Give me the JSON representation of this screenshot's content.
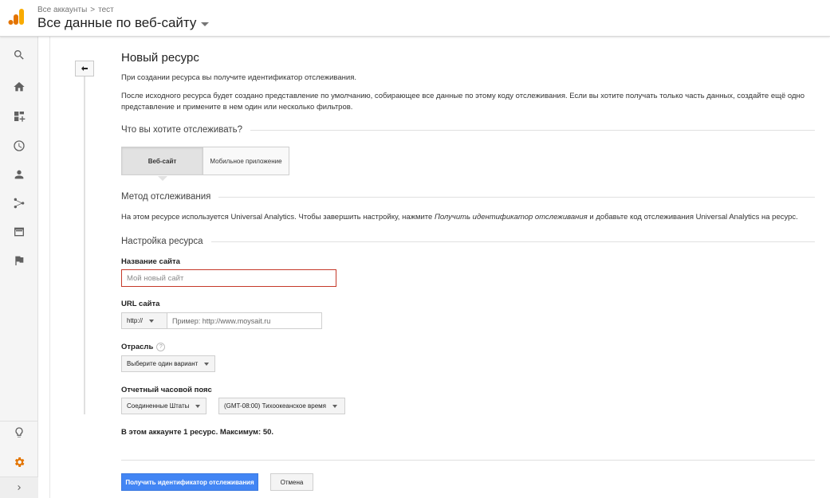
{
  "header": {
    "logo_icon": "analytics-logo-icon",
    "breadcrumb": {
      "account": "Все аккаунты",
      "separator": ">",
      "property": "тест"
    },
    "view_title": "Все данные по веб-сайту"
  },
  "rail": {
    "items": [
      {
        "icon": "search-icon"
      },
      {
        "icon": "home-icon"
      },
      {
        "icon": "customization-icon"
      },
      {
        "icon": "realtime-clock-icon"
      },
      {
        "icon": "audience-person-icon"
      },
      {
        "icon": "acquisition-icon"
      },
      {
        "icon": "behavior-icon"
      },
      {
        "icon": "conversions-flag-icon"
      }
    ],
    "bottom": [
      {
        "icon": "discover-lightbulb-icon"
      },
      {
        "icon": "admin-gear-icon",
        "color": "#e37400"
      },
      {
        "icon": "expand-chevron-icon"
      }
    ]
  },
  "form": {
    "title": "Новый ресурс",
    "intro1": "При создании ресурса вы получите идентификатор отслеживания.",
    "intro2": "После исходного ресурса будет создано представление по умолчанию, собирающее все данные по этому коду отслеживания. Если вы хотите получать только часть данных, создайте ещё одно представление и примените в нем один или несколько фильтров.",
    "track_section": "Что вы хотите отслеживать?",
    "track_options": {
      "website": "Веб-сайт",
      "mobile": "Мобильное приложение"
    },
    "method_section": "Метод отслеживания",
    "method_text_1": "На этом ресурсе используется Universal Analytics. Чтобы завершить настройку, нажмите ",
    "method_text_em": "Получить идентификатор отслеживания",
    "method_text_2": " и добавьте код отслеживания Universal Analytics на ресурс.",
    "setup_section": "Настройка ресурса",
    "site_name_label": "Название сайта",
    "site_name_placeholder": "Мой новый сайт",
    "site_url_label": "URL сайта",
    "protocol_value": "http://",
    "url_placeholder": "Пример: http://www.moysait.ru",
    "industry_label": "Отрасль",
    "help_symbol": "?",
    "industry_value": "Выберите один вариант",
    "timezone_label": "Отчетный часовой пояс",
    "country_value": "Соединенные Штаты",
    "timezone_value": "(GMT-08:00) Тихоокеанское время",
    "limit_text": "В этом аккаунте 1 ресурс. Максимум: 50.",
    "submit_label": "Получить идентификатор отслеживания",
    "cancel_label": "Отмена"
  },
  "colors": {
    "accent": "#4285f4",
    "error_border": "#c53929",
    "admin_icon": "#e37400",
    "logo_yellow": "#f9ab00",
    "logo_orange": "#e37400"
  }
}
